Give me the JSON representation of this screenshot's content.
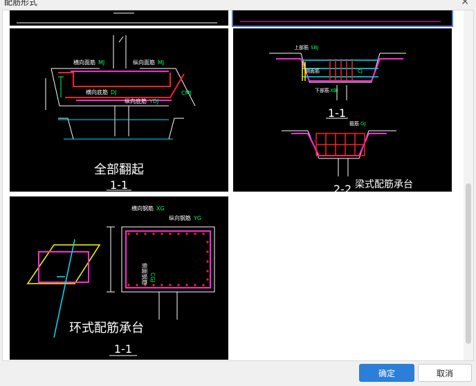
{
  "dialog": {
    "title": "配筋形式",
    "close_glyph": "✕"
  },
  "thumbnails": [
    {
      "caption": "全部翻起",
      "section": "1-1",
      "labels": {
        "transverse_top": "横向面筋",
        "transverse_top_code": "MJ",
        "longitudinal_top": "纵向面筋",
        "longitudinal_top_code": "MJ",
        "transverse_bottom": "横向底筋",
        "transverse_bottom_code": "DJ",
        "longitudinal_bottom": "纵向底筋",
        "longitudinal_bottom_code": "YDJ",
        "side": "CMJ"
      }
    },
    {
      "caption": "梁式配筋承台",
      "section_top": "1-1",
      "section_bottom": "2-2",
      "labels": {
        "top_bar": "上部筋",
        "top_bar_code": "SBJ",
        "side_bar": "侧面筋",
        "side_bar_code": "CJ",
        "bottom_bar": "下部筋",
        "bottom_bar_code": "XBJ",
        "stirrup": "箍筋",
        "stirrup_code": "GJ"
      }
    },
    {
      "caption": "环式配筋承台",
      "section": "1-1",
      "labels": {
        "transverse": "横向钢筋",
        "transverse_code": "XG",
        "longitudinal": "纵向钢筋",
        "longitudinal_code": "YG",
        "side": "侧面钢筋",
        "side_code": "CGJ"
      }
    }
  ],
  "buttons": {
    "ok": "确定",
    "cancel": "取消"
  },
  "colors": {
    "accent": "#2d7ed8",
    "thumb_bg": "#000000",
    "rebar_magenta": "#ff2bd6",
    "rebar_red": "#ff2020",
    "dim_green": "#00ff66",
    "cyan": "#00e5ff",
    "yellow": "#ffff00"
  }
}
